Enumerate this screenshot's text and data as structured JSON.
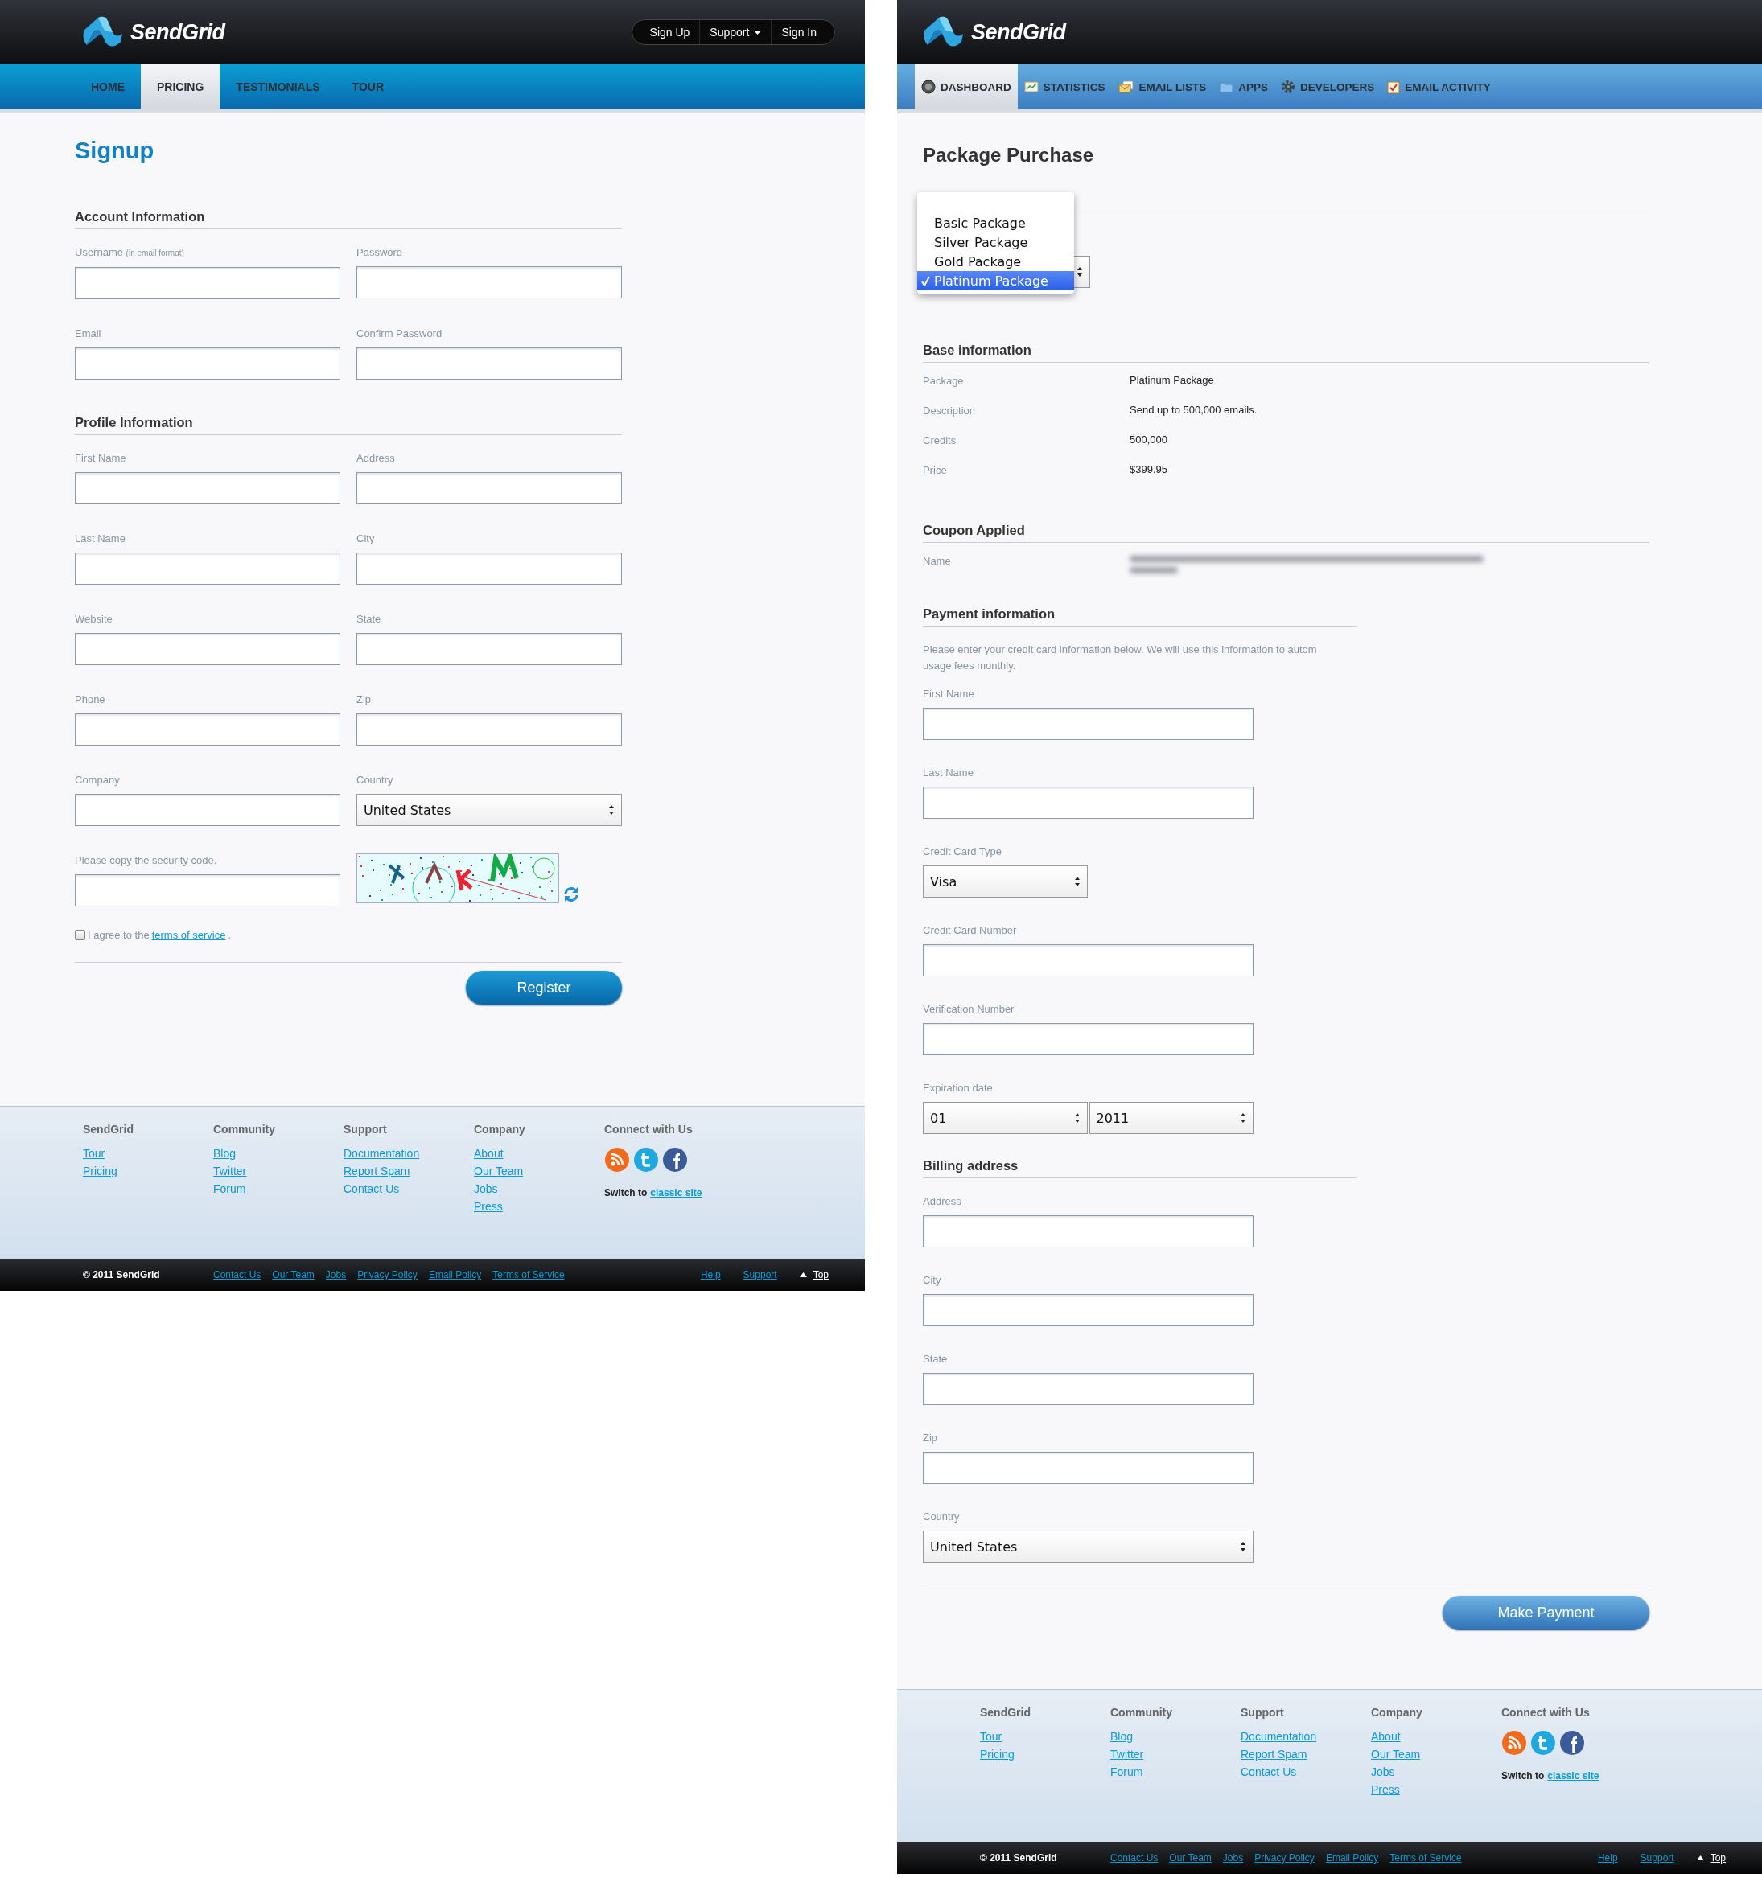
{
  "signup_page": {
    "header": {
      "logo": "SendGrid",
      "top_links": [
        {
          "label": "Sign Up",
          "has_menu": false
        },
        {
          "label": "Support",
          "has_menu": true
        },
        {
          "label": "Sign In",
          "has_menu": false
        }
      ]
    },
    "nav": [
      {
        "label": "HOME",
        "selected": false
      },
      {
        "label": "PRICING",
        "selected": true
      },
      {
        "label": "TESTIMONIALS",
        "selected": false
      },
      {
        "label": "TOUR",
        "selected": false
      }
    ],
    "title": "Signup",
    "sections": [
      {
        "heading": "Account Information",
        "fields": [
          {
            "label": "Username",
            "hint": "(in email format)",
            "kind": "text"
          },
          {
            "label": "Password",
            "kind": "text"
          },
          {
            "label": "Email",
            "kind": "text"
          },
          {
            "label": "Confirm Password",
            "kind": "text"
          }
        ]
      },
      {
        "heading": "Profile Information",
        "fields": [
          {
            "label": "First Name",
            "kind": "text"
          },
          {
            "label": "Address",
            "kind": "text"
          },
          {
            "label": "Last Name",
            "kind": "text"
          },
          {
            "label": "City",
            "kind": "text"
          },
          {
            "label": "Website",
            "kind": "text"
          },
          {
            "label": "State",
            "kind": "text"
          },
          {
            "label": "Phone",
            "kind": "text"
          },
          {
            "label": "Zip",
            "kind": "text"
          },
          {
            "label": "Company",
            "kind": "text"
          },
          {
            "label": "Country",
            "kind": "select",
            "value": "United States"
          },
          {
            "label": "Please copy the security code.",
            "kind": "text"
          },
          {
            "kind": "captcha"
          }
        ]
      }
    ],
    "agree": {
      "checked": false,
      "text": "I agree to the",
      "link": "terms of service",
      "end": "."
    },
    "button": "Register",
    "footer": {
      "columns": [
        {
          "heading": "SendGrid",
          "links": [
            "Tour",
            "Pricing"
          ]
        },
        {
          "heading": "Community",
          "links": [
            "Blog",
            "Twitter",
            "Forum"
          ]
        },
        {
          "heading": "Support",
          "links": [
            "Documentation",
            "Report Spam",
            "Contact Us"
          ]
        },
        {
          "heading": "Company",
          "links": [
            "About",
            "Our Team",
            "Jobs",
            "Press"
          ]
        }
      ],
      "connect": {
        "heading": "Connect with Us",
        "switch_text": "Switch to",
        "switch_link": "classic site"
      },
      "copyright": "© 2011 SendGrid",
      "links": [
        "Contact Us",
        "Our Team",
        "Jobs",
        "Privacy Policy",
        "Email Policy",
        "Terms of Service"
      ],
      "right_links": [
        "Help",
        "Support"
      ],
      "top": "Top"
    }
  },
  "purchase_page": {
    "header": {
      "logo": "SendGrid"
    },
    "nav": [
      {
        "label": "DASHBOARD",
        "selected": true
      },
      {
        "label": "STATISTICS",
        "selected": false
      },
      {
        "label": "EMAIL LISTS",
        "selected": false
      },
      {
        "label": "APPS",
        "selected": false
      },
      {
        "label": "DEVELOPERS",
        "selected": false
      },
      {
        "label": "EMAIL ACTIVITY",
        "selected": false
      }
    ],
    "title": "Package Purchase",
    "package_menu": [
      {
        "label": "Basic Package",
        "selected": false
      },
      {
        "label": "Silver Package",
        "selected": false
      },
      {
        "label": "Gold Package",
        "selected": false
      },
      {
        "label": "Platinum Package",
        "selected": true
      }
    ],
    "base_info": {
      "heading": "Base information",
      "rows": [
        {
          "label": "Package",
          "value": "Platinum Package"
        },
        {
          "label": "Description",
          "value": "Send up to 500,000 emails."
        },
        {
          "label": "Credits",
          "value": "500,000"
        },
        {
          "label": "Price",
          "value": "$399.95"
        }
      ]
    },
    "coupon": {
      "heading": "Coupon Applied",
      "rows": [
        {
          "label": "Name"
        }
      ]
    },
    "payment": {
      "heading": "Payment information",
      "note": [
        "Please enter your credit card information below. We will use this information to autom",
        "usage fees monthly."
      ],
      "fields": [
        {
          "label": "First Name",
          "kind": "text"
        },
        {
          "label": "Last Name",
          "kind": "text"
        },
        {
          "label": "Credit Card Type",
          "kind": "select",
          "value": "Visa"
        },
        {
          "label": "Credit Card Number",
          "kind": "text"
        },
        {
          "label": "Verification Number",
          "kind": "text"
        },
        {
          "label": "Expiration date",
          "kind": "select_pair",
          "values": [
            "01",
            "2011"
          ]
        }
      ]
    },
    "billing": {
      "heading": "Billing address",
      "fields": [
        {
          "label": "Address",
          "kind": "text"
        },
        {
          "label": "City",
          "kind": "text"
        },
        {
          "label": "State",
          "kind": "text"
        },
        {
          "label": "Zip",
          "kind": "text"
        },
        {
          "label": "Country",
          "kind": "select_wide",
          "value": "United States"
        }
      ]
    },
    "button": "Make Payment",
    "footer": {
      "columns": [
        {
          "heading": "SendGrid",
          "links": [
            "Tour",
            "Pricing"
          ]
        },
        {
          "heading": "Community",
          "links": [
            "Blog",
            "Twitter",
            "Forum"
          ]
        },
        {
          "heading": "Support",
          "links": [
            "Documentation",
            "Report Spam",
            "Contact Us"
          ]
        },
        {
          "heading": "Company",
          "links": [
            "About",
            "Our Team",
            "Jobs",
            "Press"
          ]
        }
      ],
      "connect": {
        "heading": "Connect with Us",
        "switch_text": "Switch to",
        "switch_link": "classic site"
      },
      "copyright": "© 2011 SendGrid",
      "links": [
        "Contact Us",
        "Our Team",
        "Jobs",
        "Privacy Policy",
        "Email Policy",
        "Terms of Service"
      ],
      "right_links": [
        "Help",
        "Support"
      ],
      "top": "Top"
    }
  }
}
